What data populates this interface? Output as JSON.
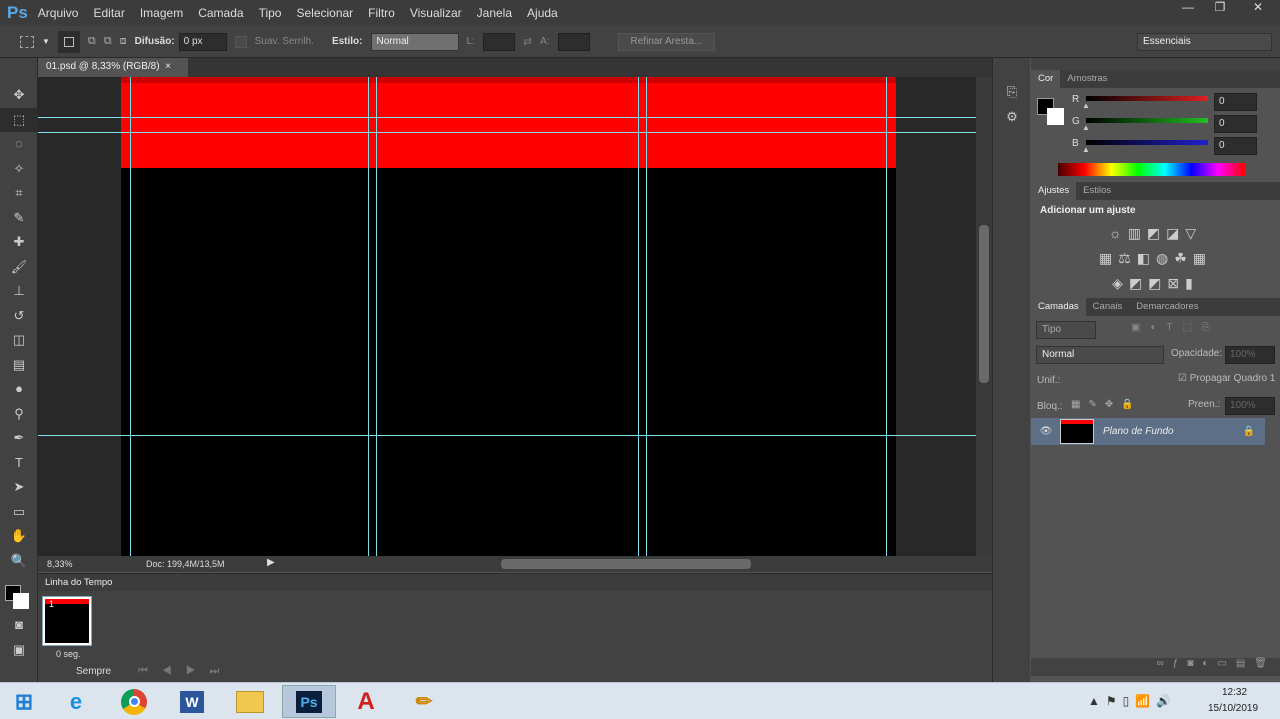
{
  "app": {
    "logo": "Ps",
    "menu": [
      "Arquivo",
      "Editar",
      "Imagem",
      "Camada",
      "Tipo",
      "Selecionar",
      "Filtro",
      "Visualizar",
      "Janela",
      "Ajuda"
    ],
    "window_buttons": [
      "—",
      "❐",
      "✕"
    ]
  },
  "options": {
    "feather_label": "Difusão:",
    "feather_value": "0 px",
    "antialias_label": "Suav. Serrilh.",
    "style_label": "Estilo:",
    "style_value": "Normal",
    "width_label": "L:",
    "height_label": "A:",
    "refine_label": "Refinar Aresta...",
    "workspace": "Essenciais"
  },
  "document": {
    "tab": "01.psd @ 8,33% (RGB/8)",
    "close": "×",
    "zoom": "8,33%",
    "doc_info": "Doc: 199,4M/13,5M",
    "band_color": "#ff0000"
  },
  "timeline": {
    "title": "Linha do Tempo",
    "frame_number": "1",
    "frame_delay": "0 seg.",
    "loop": "Sempre"
  },
  "color_panel": {
    "tabs": [
      "Cor",
      "Amostras"
    ],
    "channels": [
      {
        "label": "R",
        "value": "0",
        "color": "#e02020"
      },
      {
        "label": "G",
        "value": "0",
        "color": "#20c020"
      },
      {
        "label": "B",
        "value": "0",
        "color": "#2020d0"
      }
    ]
  },
  "adjust_panel": {
    "tabs": [
      "Ajustes",
      "Estilos"
    ],
    "title": "Adicionar um ajuste"
  },
  "layers_panel": {
    "tabs": [
      "Camadas",
      "Canais",
      "Demarcadores"
    ],
    "filter": "Tipo",
    "blend": "Normal",
    "opacity_label": "Opacidade:",
    "opacity": "100%",
    "unify_label": "Unif.:",
    "propagate": "Propagar Quadro 1",
    "lock_label": "Bloq.:",
    "fill_label": "Preen.:",
    "fill": "100%",
    "layers": [
      {
        "name": "Plano de Fundo",
        "locked": true,
        "visible": true
      }
    ]
  },
  "taskbar": {
    "time": "12:32",
    "date": "15/10/2019"
  }
}
